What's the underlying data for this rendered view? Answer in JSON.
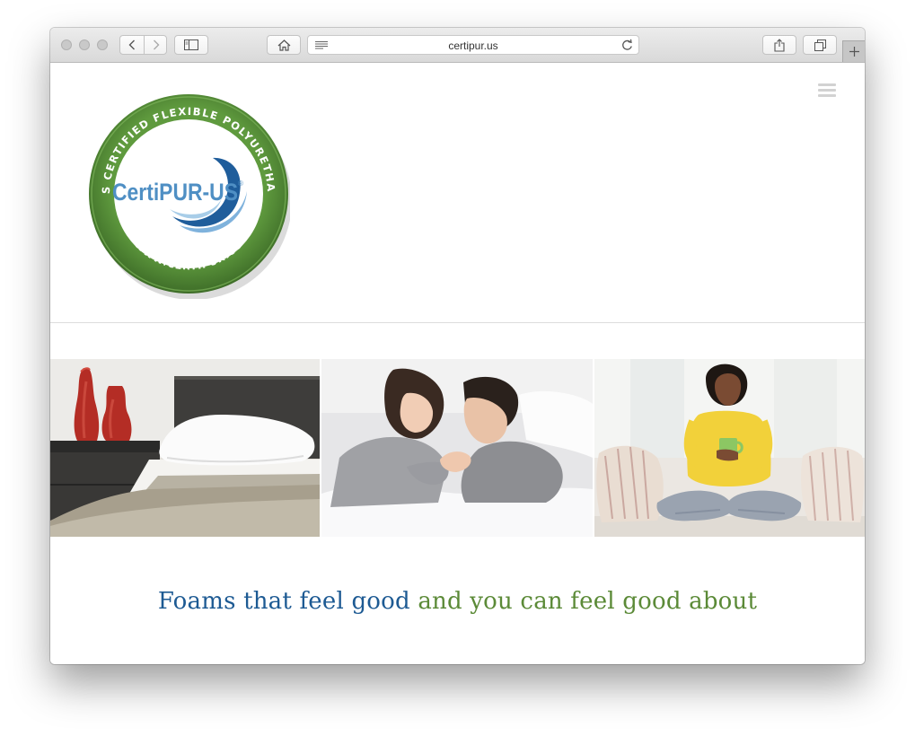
{
  "browser": {
    "url": "certipur.us",
    "traffic_lights": [
      "close",
      "minimize",
      "zoom"
    ],
    "buttons": [
      "back",
      "forward",
      "sidebar",
      "home",
      "share",
      "tabs",
      "new-tab"
    ]
  },
  "site": {
    "logo": {
      "brand_text": "CertiPUR-US",
      "registered_mark": "®",
      "ring_text_top": "CONTAINS CERTIFIED FLEXIBLE POLYURETHANE FOAM",
      "ring_text_bottom": "WWW.CERTIPUR.US"
    },
    "tagline": {
      "part1": "Foams that feel good",
      "part2": "and you can feel good about"
    },
    "hero_images": [
      "bedroom-pillow-photo",
      "couple-in-bed-photo",
      "woman-with-mug-photo"
    ]
  },
  "colors": {
    "brand_green": "#5b8a37",
    "brand_blue": "#1d5a93",
    "logo_light_blue": "#4f8fc4"
  }
}
